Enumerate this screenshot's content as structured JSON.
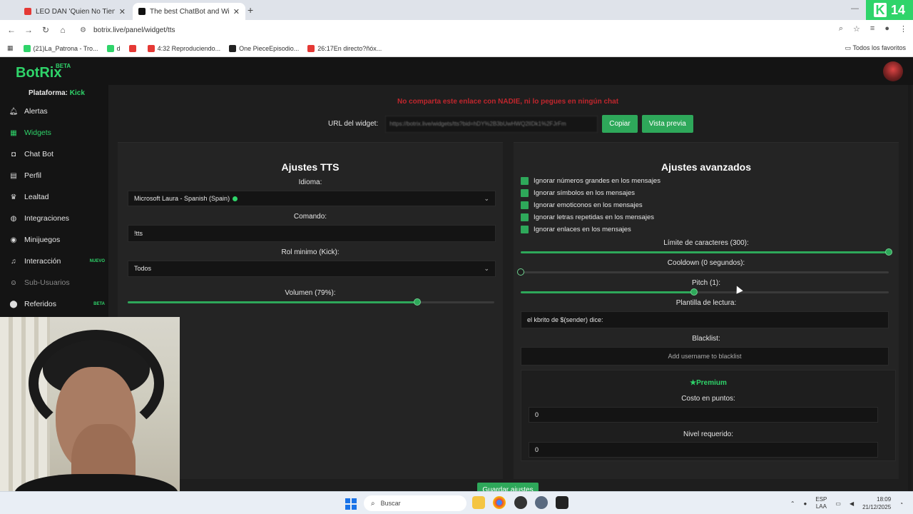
{
  "browser": {
    "tabs": [
      {
        "title": "LEO DAN 'Quien No Tiene Una",
        "favicon_color": "#e53935"
      },
      {
        "title": "The best ChatBot and Widgets",
        "favicon_color": "#111111"
      }
    ],
    "new_tab": "+",
    "url": "botrix.live/panel/widget/tts",
    "kick_badge_number": "14",
    "bookmarks": [
      {
        "label": "(21)La_Patrona - Tro...",
        "color": "#2fd46a"
      },
      {
        "label": "d",
        "color": "#2fd46a"
      },
      {
        "label": "",
        "color": "#e53935"
      },
      {
        "label": "4:32 Reproduciendo...",
        "color": "#e53935"
      },
      {
        "label": "One PieceEpisodio...",
        "color": "#222222"
      },
      {
        "label": "26:17En directo?ñóx...",
        "color": "#e53935"
      }
    ],
    "all_favorites": "Todos los favoritos"
  },
  "app": {
    "logo": "BotRix",
    "logo_badge": "BETA",
    "platform_label": "Plataforma:",
    "platform_value": "Kick",
    "nav": [
      {
        "label": "Alertas",
        "icon": "bell-icon"
      },
      {
        "label": "Widgets",
        "icon": "grid-icon",
        "active": true
      },
      {
        "label": "Chat Bot",
        "icon": "robot-icon"
      },
      {
        "label": "Perfil",
        "icon": "id-card-icon"
      },
      {
        "label": "Lealtad",
        "icon": "trophy-icon"
      },
      {
        "label": "Integraciones",
        "icon": "globe-icon"
      },
      {
        "label": "Minijuegos",
        "icon": "gamepad-icon"
      },
      {
        "label": "Interacción",
        "icon": "music-icon",
        "tag": "NUEVO"
      },
      {
        "label": "Sub-Usuarios",
        "icon": "users-icon",
        "dim": true
      },
      {
        "label": "Referidos",
        "icon": "referral-icon",
        "tag": "BETA"
      }
    ]
  },
  "main": {
    "warning": "No comparta este enlace con NADIE, ni lo pegues en ningún chat",
    "url_label": "URL del widget:",
    "url_value": "https://botrix.live/widgets/tts?bid=hDY%2B3bUwHWQ2lIDk1%2FJrFm",
    "copy_label": "Copiar",
    "preview_label": "Vista previa",
    "save_label": "Guardar ajustes"
  },
  "tts": {
    "title": "Ajustes TTS",
    "language_label": "Idioma:",
    "language_value": "Microsoft Laura - Spanish (Spain)",
    "command_label": "Comando:",
    "command_value": "!tts",
    "role_label": "Rol minimo (Kick):",
    "role_value": "Todos",
    "volume_label": "Volumen (79%):",
    "volume_percent": 79
  },
  "advanced": {
    "title": "Ajustes avanzados",
    "checkboxes": [
      "Ignorar números grandes en los mensajes",
      "Ignorar símbolos en los mensajes",
      "Ignorar emoticonos en los mensajes",
      "Ignorar letras repetidas en los mensajes",
      "Ignorar enlaces en los mensajes"
    ],
    "char_limit_label": "Límite de caracteres (300):",
    "char_limit_fraction": 1.0,
    "cooldown_label": "Cooldown (0 segundos):",
    "cooldown_fraction": 0.0,
    "pitch_label": "Pitch (1):",
    "pitch_fraction": 0.47,
    "template_label": "Plantilla de lectura:",
    "template_value": "el kbrito de $(sender) dice:",
    "blacklist_label": "Blacklist:",
    "blacklist_placeholder": "Add username to blacklist",
    "premium_label": "Premium",
    "cost_label": "Costo en puntos:",
    "cost_value": "0",
    "level_label": "Nivel requerido:",
    "level_value": "0"
  },
  "taskbar": {
    "search": "Buscar",
    "lang_top": "ESP",
    "lang_bottom": "LAA",
    "time": "18:09",
    "date": "21/12/2025"
  },
  "colors": {
    "accent": "#2ea85a",
    "brand": "#2fd46a",
    "warning": "#c0262d"
  }
}
